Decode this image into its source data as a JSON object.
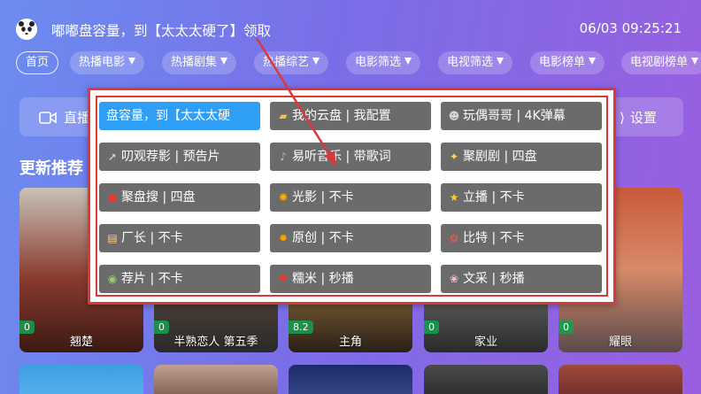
{
  "header": {
    "notice": "嘟嘟盘容量，到【太太太硬了】领取",
    "clock": "06/03 09:25:21"
  },
  "tabs": [
    {
      "label": "首页",
      "dropdown": false
    },
    {
      "label": "热播电影",
      "dropdown": true
    },
    {
      "label": "热播剧集",
      "dropdown": true
    },
    {
      "label": "热播综艺",
      "dropdown": true
    },
    {
      "label": "电影筛选",
      "dropdown": true
    },
    {
      "label": "电视筛选",
      "dropdown": true
    },
    {
      "label": "电影榜单",
      "dropdown": true
    },
    {
      "label": "电视剧榜单",
      "dropdown": true
    }
  ],
  "feature_bar": {
    "left_label": "直播",
    "right_label": "设置"
  },
  "section": {
    "title": "更新推荐"
  },
  "posters": [
    {
      "title": "翘楚",
      "score": "0"
    },
    {
      "title": "半熟恋人 第五季",
      "score": "0"
    },
    {
      "title": "主角",
      "score": "8.2"
    },
    {
      "title": "家业",
      "score": "0"
    },
    {
      "title": "耀眼",
      "score": "0"
    }
  ],
  "popup": {
    "sources": [
      {
        "label": "盘容量，到【太太太硬",
        "icon": "",
        "selected": true
      },
      {
        "label": "我的云盘 | 我配置",
        "icon": "folder-icon",
        "selected": false
      },
      {
        "label": "玩偶哥哥 | 4K弹幕",
        "icon": "alien-icon",
        "selected": false
      },
      {
        "label": "叨观荐影 | 预告片",
        "icon": "rocket-icon",
        "selected": false
      },
      {
        "label": "易听音乐 | 带歌词",
        "icon": "microphone-icon",
        "selected": false
      },
      {
        "label": "聚剧剧 | 四盘",
        "icon": "bulb-icon",
        "selected": false
      },
      {
        "label": "聚盘搜 | 四盘",
        "icon": "balloon-icon",
        "selected": false
      },
      {
        "label": "光影 | 不卡",
        "icon": "sun-icon",
        "selected": false
      },
      {
        "label": "立播 | 不卡",
        "icon": "star-icon",
        "selected": false
      },
      {
        "label": "厂长 | 不卡",
        "icon": "notebook-icon",
        "selected": false
      },
      {
        "label": "原创 | 不卡",
        "icon": "sun-small-icon",
        "selected": false
      },
      {
        "label": "比特 | 不卡",
        "icon": "mushroom-icon",
        "selected": false
      },
      {
        "label": "荐片 | 不卡",
        "icon": "kiwi-icon",
        "selected": false
      },
      {
        "label": "糯米 | 秒播",
        "icon": "strawberry-icon",
        "selected": false
      },
      {
        "label": "文采 | 秒播",
        "icon": "flower-icon",
        "selected": false
      }
    ]
  },
  "colors": {
    "highlight_border": "#d9393b",
    "selected_button": "#2f9ef5",
    "button": "#6b6b6b",
    "annotation_arrow": "#d9393b"
  }
}
